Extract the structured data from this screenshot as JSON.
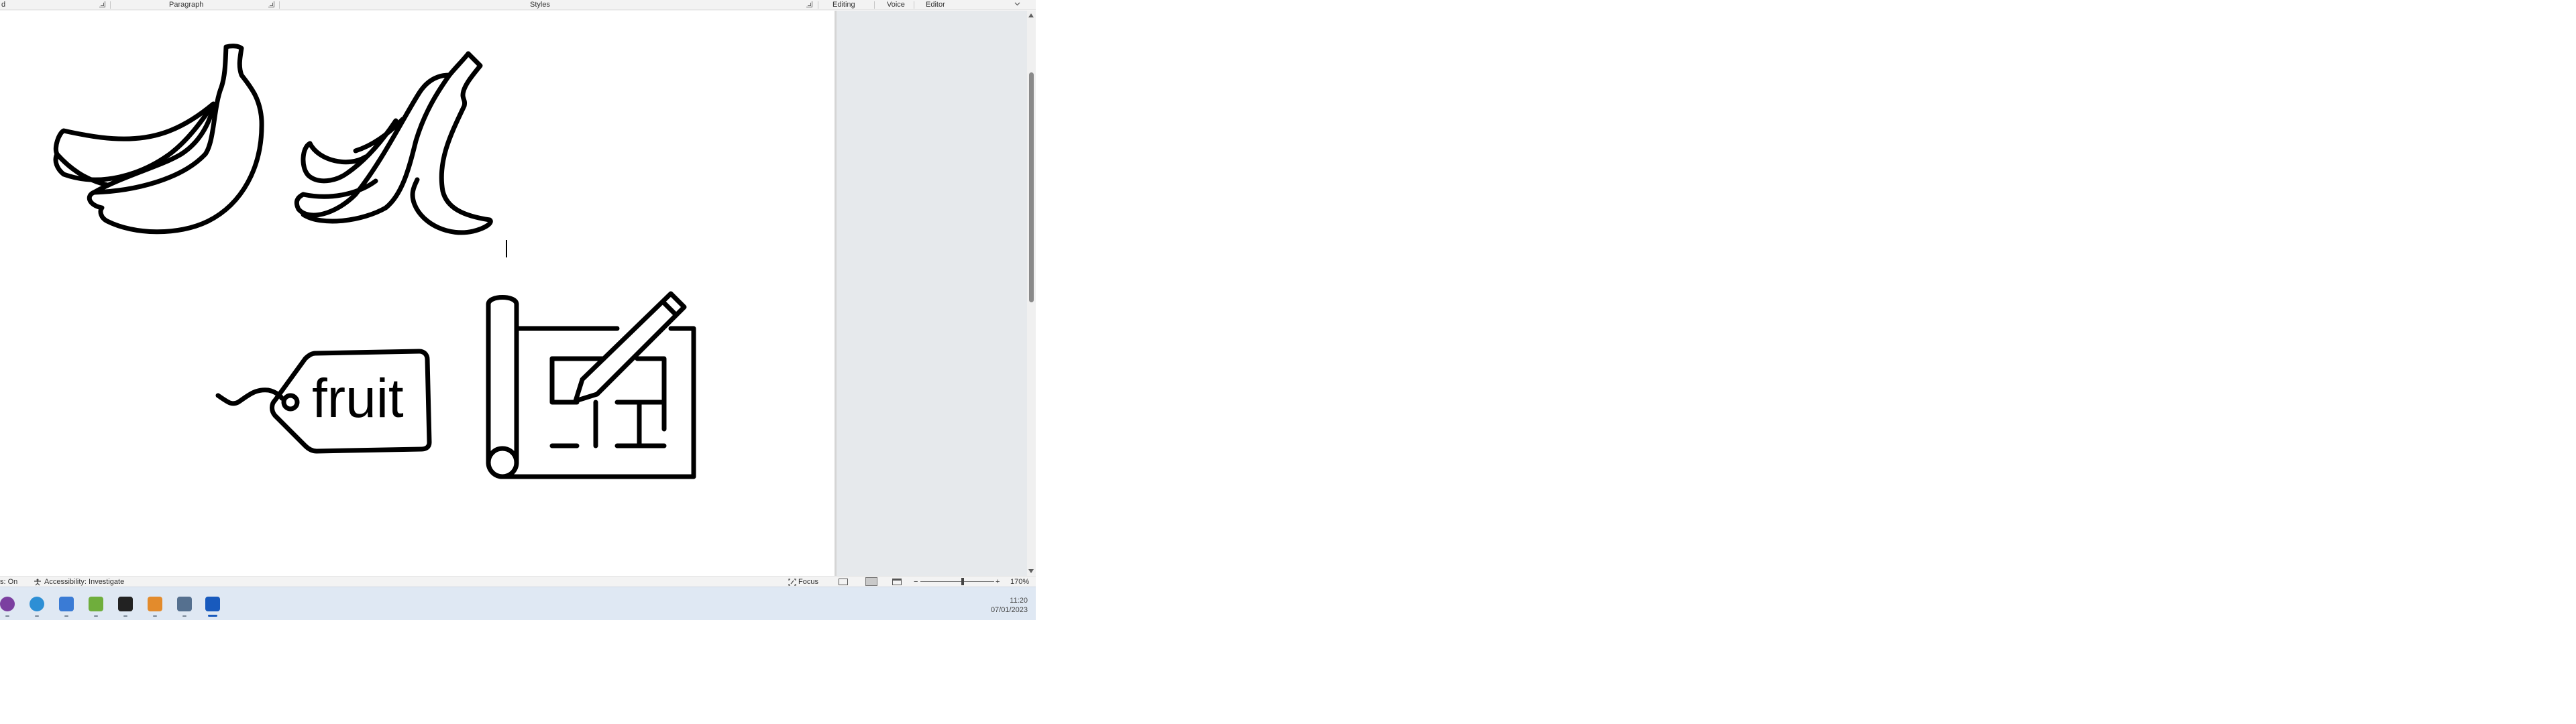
{
  "ribbon": {
    "groups": {
      "font_partial": "d",
      "paragraph": "Paragraph",
      "styles": "Styles",
      "editing": "Editing",
      "voice": "Voice",
      "editor": "Editor"
    }
  },
  "document": {
    "tag_text": "fruit",
    "icons": [
      "bananas-icon",
      "peeled-banana-icon",
      "tag-icon",
      "blueprint-icon"
    ]
  },
  "statusbar": {
    "track_changes_partial": "s: On",
    "accessibility": "Accessibility: Investigate",
    "focus": "Focus",
    "zoom_minus": "−",
    "zoom_plus": "+",
    "zoom_level": "170%"
  },
  "taskbar": {
    "apps": [
      "tor-browser-icon",
      "edge-icon",
      "word-pad-icon",
      "paint-icon",
      "terminal-icon",
      "snipping-icon",
      "notepad-icon",
      "word-icon"
    ],
    "time": "11:20",
    "date": "07/01/2023"
  }
}
